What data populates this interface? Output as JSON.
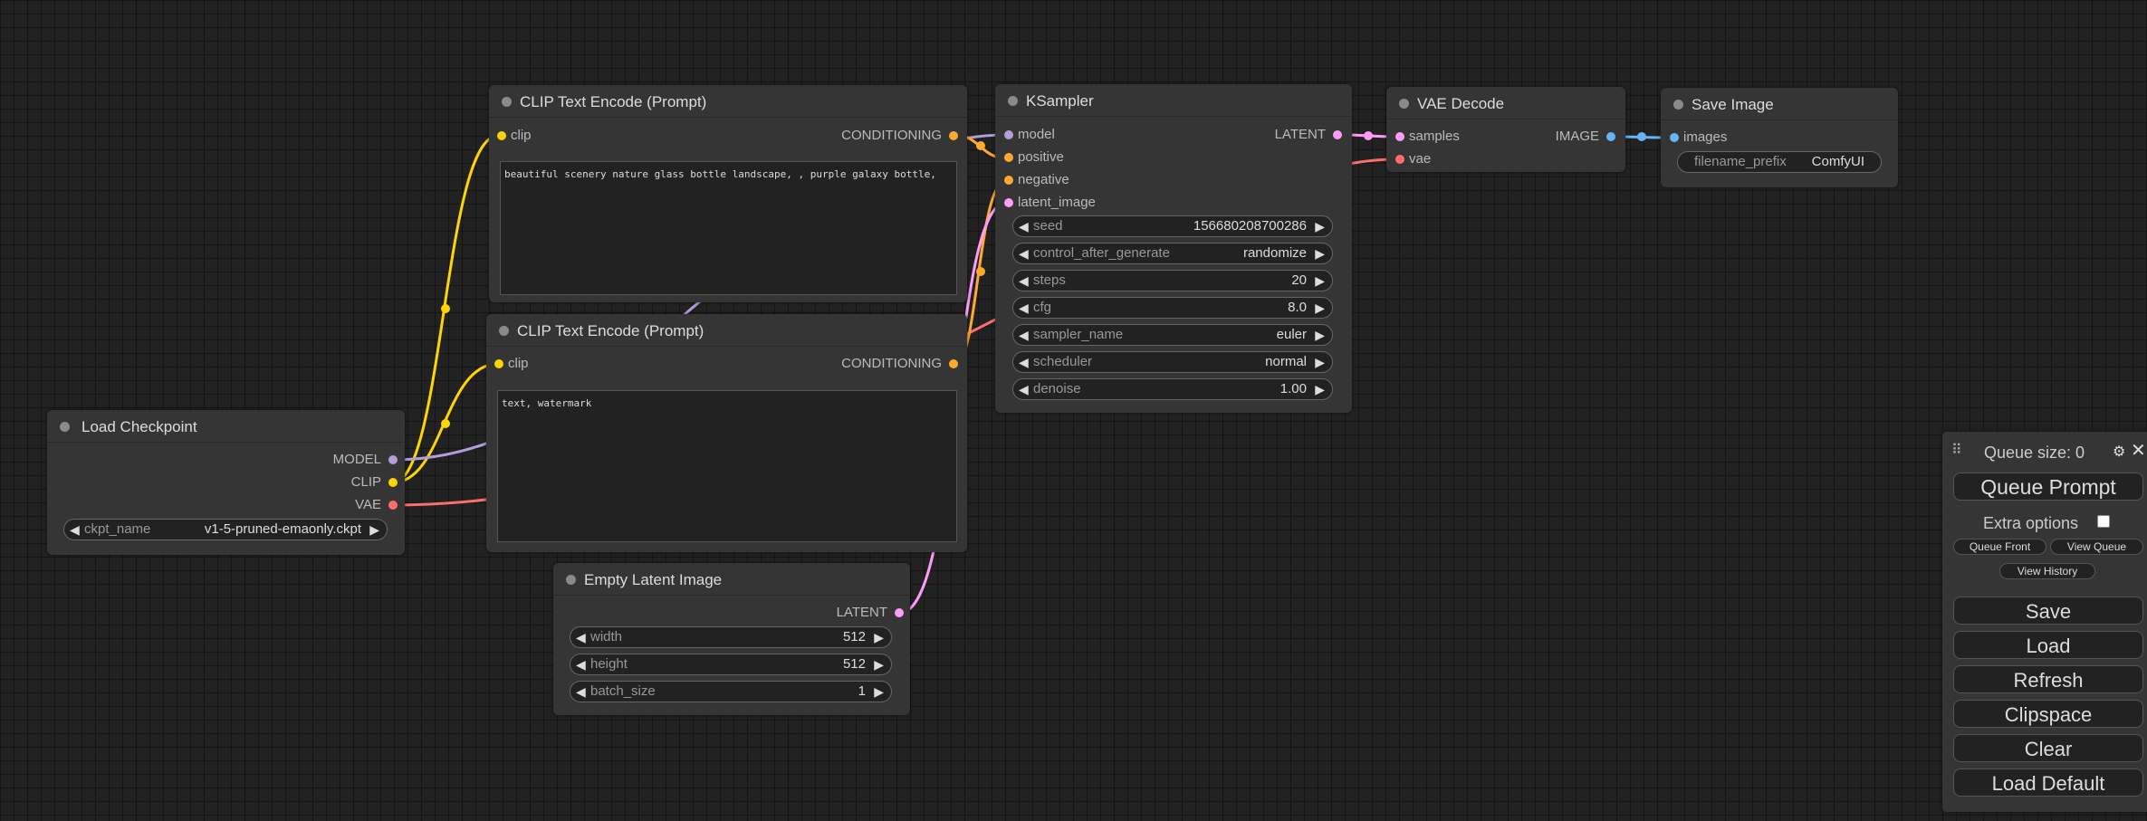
{
  "nodes": {
    "clip_pos": {
      "title": "CLIP Text Encode (Prompt)",
      "input": "clip",
      "output": "CONDITIONING",
      "text": "beautiful scenery nature glass bottle landscape, , purple galaxy bottle,"
    },
    "clip_neg": {
      "title": "CLIP Text Encode (Prompt)",
      "input": "clip",
      "output": "CONDITIONING",
      "text": "text, watermark"
    },
    "ksampler": {
      "title": "KSampler",
      "inputs": [
        "model",
        "positive",
        "negative",
        "latent_image"
      ],
      "output": "LATENT",
      "widgets": [
        {
          "label": "seed",
          "value": "156680208700286"
        },
        {
          "label": "control_after_generate",
          "value": "randomize"
        },
        {
          "label": "steps",
          "value": "20"
        },
        {
          "label": "cfg",
          "value": "8.0"
        },
        {
          "label": "sampler_name",
          "value": "euler"
        },
        {
          "label": "scheduler",
          "value": "normal"
        },
        {
          "label": "denoise",
          "value": "1.00"
        }
      ]
    },
    "vae_decode": {
      "title": "VAE Decode",
      "inputs": [
        "samples",
        "vae"
      ],
      "output": "IMAGE"
    },
    "save_image": {
      "title": "Save Image",
      "input": "images",
      "widget": {
        "label": "filename_prefix",
        "value": "ComfyUI"
      }
    },
    "load_checkpoint": {
      "title": "Load Checkpoint",
      "outputs": [
        "MODEL",
        "CLIP",
        "VAE"
      ],
      "widget": {
        "label": "ckpt_name",
        "value": "v1-5-pruned-emaonly.ckpt"
      }
    },
    "empty_latent": {
      "title": "Empty Latent Image",
      "output": "LATENT",
      "widgets": [
        {
          "label": "width",
          "value": "512"
        },
        {
          "label": "height",
          "value": "512"
        },
        {
          "label": "batch_size",
          "value": "1"
        }
      ]
    }
  },
  "menu": {
    "queue_size": "Queue size: 0",
    "queue_prompt": "Queue Prompt",
    "extra_options": "Extra options",
    "queue_front": "Queue Front",
    "view_queue": "View Queue",
    "view_history": "View History",
    "save": "Save",
    "load": "Load",
    "refresh": "Refresh",
    "clipspace": "Clipspace",
    "clear": "Clear",
    "load_default": "Load Default"
  },
  "colors": {
    "clip": "#FFD500",
    "conditioning": "#FFA931",
    "model": "#B39DDB",
    "latent": "#FF9CF9",
    "vae": "#FF6E6E",
    "image": "#64B5F6"
  }
}
